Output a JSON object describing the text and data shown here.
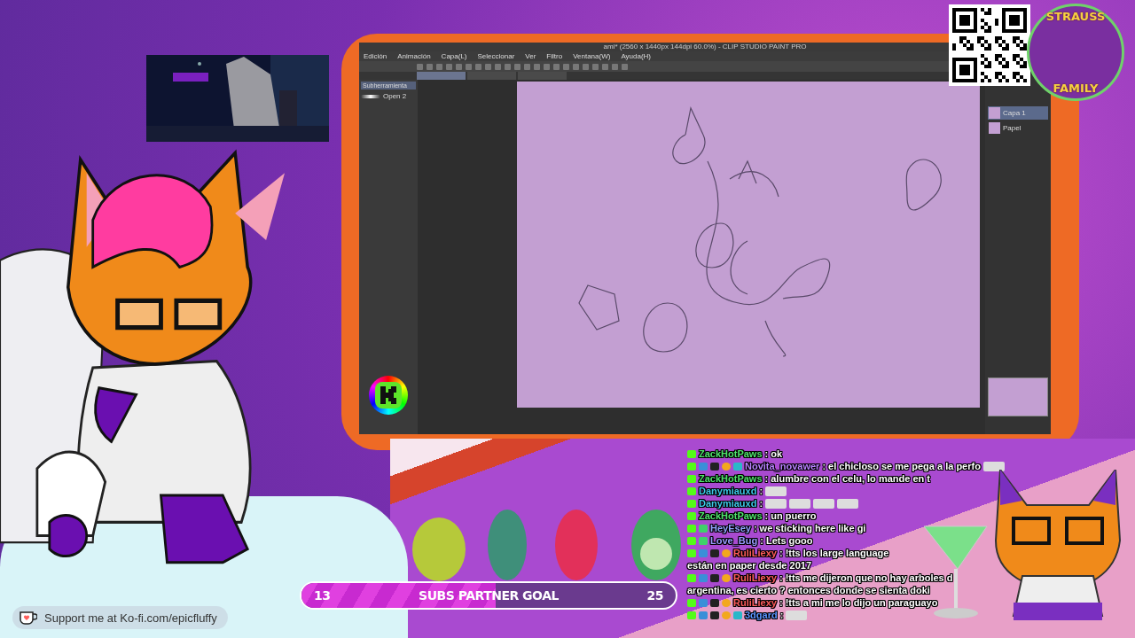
{
  "app": {
    "title": "ami* (2560 x 1440px 144dpi 60.0%) - CLIP STUDIO PAINT PRO",
    "menu": [
      "Edición",
      "Animación",
      "Capa(L)",
      "Seleccionar",
      "Ver",
      "Filtro",
      "Ventana(W)",
      "Ayuda(H)"
    ],
    "tabs": [
      {
        "selected": true
      },
      {
        "selected": false
      },
      {
        "selected": false
      }
    ],
    "subtool_header": "Subherramienta",
    "brushes": [
      "Open 2"
    ],
    "layers": [
      {
        "name": "Capa 1",
        "selected": true
      },
      {
        "name": "Papel",
        "selected": false
      }
    ]
  },
  "chat": [
    {
      "user": "ZackHotPaws",
      "color": "#4fe36c",
      "badges": [
        {
          "kind": "kick"
        }
      ],
      "text": ": ok"
    },
    {
      "user": "Novita_novawer",
      "color": "#b980ff",
      "badges": [
        {
          "kind": "kick"
        },
        {
          "kind": "tv"
        },
        {
          "kind": "shoe"
        },
        {
          "kind": "coin"
        },
        {
          "kind": "grid"
        }
      ],
      "text": ": el chicloso se me pega a la perfo",
      "emotes": [
        {
          "kind": "emote"
        }
      ]
    },
    {
      "user": "ZackHotPaws",
      "color": "#4fe36c",
      "badges": [
        {
          "kind": "kick"
        }
      ],
      "text": ": alumbre con el celu, lo mande en t"
    },
    {
      "user": "Danymiauxd",
      "color": "#3cc8e8",
      "badges": [
        {
          "kind": "kick"
        }
      ],
      "text": ":",
      "emotes": [
        {
          "kind": "emote"
        }
      ]
    },
    {
      "user": "Danymiauxd",
      "color": "#3cc8e8",
      "badges": [
        {
          "kind": "kick"
        }
      ],
      "text": ":",
      "emotes": [
        {
          "kind": "emote"
        },
        {
          "kind": "emote"
        },
        {
          "kind": "emote"
        },
        {
          "kind": "emote"
        }
      ]
    },
    {
      "user": "ZackHotPaws",
      "color": "#4fe36c",
      "badges": [
        {
          "kind": "kick"
        }
      ],
      "text": ": un puerro"
    },
    {
      "user": "HeyEsey",
      "color": "#93a3ff",
      "badges": [
        {
          "kind": "kick"
        },
        {
          "kind": "smile"
        }
      ],
      "text": ": we sticking here like gi"
    },
    {
      "user": "Love_Bug",
      "color": "#9a9bff",
      "badges": [
        {
          "kind": "kick"
        },
        {
          "kind": "smile"
        }
      ],
      "text": ": Lets gooo"
    },
    {
      "user": "RuliLiexy",
      "color": "#ff5c5c",
      "badges": [
        {
          "kind": "kick"
        },
        {
          "kind": "tv"
        },
        {
          "kind": "shoe"
        },
        {
          "kind": "coin"
        }
      ],
      "text": ": !tts los large language",
      "continued": "están en paper desde 2017"
    },
    {
      "user": "RuliLiexy",
      "color": "#ff5c5c",
      "badges": [
        {
          "kind": "kick"
        },
        {
          "kind": "tv"
        },
        {
          "kind": "shoe"
        },
        {
          "kind": "coin"
        }
      ],
      "text": ": !tts me dijeron que no hay arboles d",
      "continued": "argentina, es cierto ? entonces donde se sienta doki"
    },
    {
      "user": "RuliLiexy",
      "color": "#ff5c5c",
      "badges": [
        {
          "kind": "kick"
        },
        {
          "kind": "tv"
        },
        {
          "kind": "shoe"
        },
        {
          "kind": "coin"
        }
      ],
      "text": ": !tts a mi me lo dijo un paraguayo"
    },
    {
      "user": "3dgard",
      "color": "#5b95ff",
      "badges": [
        {
          "kind": "kick"
        },
        {
          "kind": "tv"
        },
        {
          "kind": "shoe"
        },
        {
          "kind": "coin"
        },
        {
          "kind": "grid"
        }
      ],
      "text": ":",
      "emotes": [
        {
          "kind": "emote"
        }
      ]
    }
  ],
  "goal": {
    "current": "13",
    "title": "SUBS PARTNER GOAL",
    "target": "25",
    "level": 0.52
  },
  "kofi": {
    "text": "Support me at Ko-fi.com/epicfluffy"
  },
  "logo": {
    "top": "STRAUSS",
    "bottom": "FAMILY"
  }
}
